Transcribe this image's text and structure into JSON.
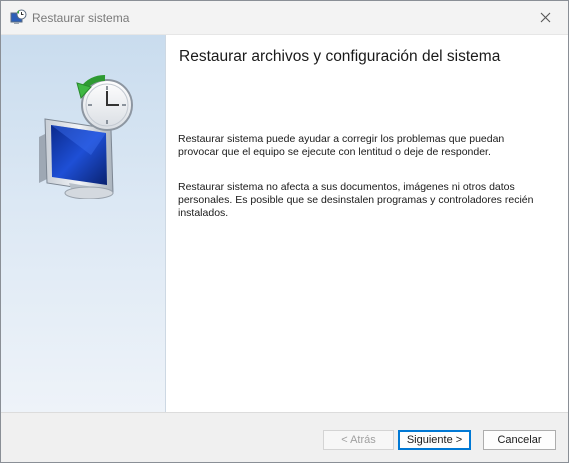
{
  "window": {
    "title": "Restaurar sistema",
    "icon": "system-restore-icon",
    "close_icon": "close-icon"
  },
  "sidepanel": {
    "image": "system-restore-monitor-clock-icon"
  },
  "main": {
    "heading": "Restaurar archivos y configuración del sistema",
    "paragraph1": "Restaurar sistema puede ayudar a corregir los problemas que puedan provocar que el equipo se ejecute con lentitud o deje de responder.",
    "paragraph2": "Restaurar sistema no afecta a sus documentos, imágenes ni otros datos personales. Es posible que se desinstalen programas y controladores recién instalados."
  },
  "footer": {
    "back_label": "< Atrás",
    "next_label": "Siguiente >",
    "cancel_label": "Cancelar"
  },
  "colors": {
    "accent": "#0078d4",
    "sidepanel_top": "#c9dcee",
    "sidepanel_bottom": "#eef3f9"
  }
}
